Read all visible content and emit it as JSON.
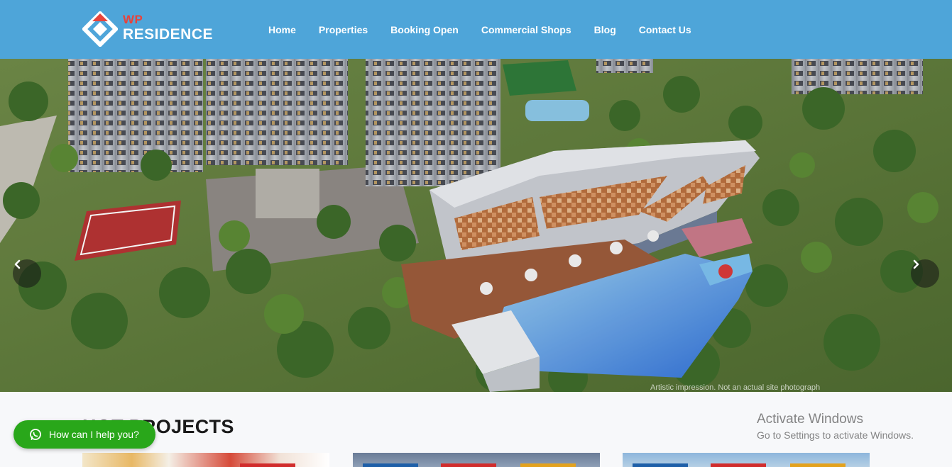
{
  "brand": {
    "line1": "WP",
    "line2": "RESIDENCE",
    "accent": "#e8433b",
    "header_bg": "#4ea5d9"
  },
  "nav": {
    "items": [
      {
        "label": "Home"
      },
      {
        "label": "Properties"
      },
      {
        "label": "Booking Open"
      },
      {
        "label": "Commercial Shops"
      },
      {
        "label": "Blog"
      },
      {
        "label": "Contact Us"
      }
    ]
  },
  "hero": {
    "caption": "Artistic impression. Not an actual site photograph",
    "prev_icon": "chevron-left-icon",
    "next_icon": "chevron-right-icon"
  },
  "projects": {
    "title": "HOT PROJECTS"
  },
  "chat": {
    "label": "How can I help you?",
    "icon": "whatsapp-icon",
    "color": "#29a71a"
  },
  "windows_notice": {
    "title": "Activate Windows",
    "subtitle": "Go to Settings to activate Windows."
  }
}
